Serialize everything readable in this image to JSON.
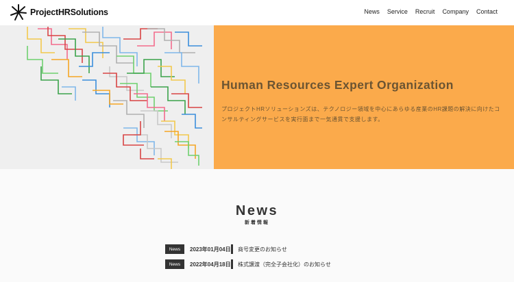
{
  "header": {
    "logo_text": "ProjectHRSolutions",
    "nav": [
      "News",
      "Service",
      "Recruit",
      "Company",
      "Contact"
    ]
  },
  "hero": {
    "title": "Human Resources Expert Organization",
    "description": "プロジェクトHRソリューションズは、テクノロジー領域を中心にあらゆる産業のHR課題の解決に向けたコンサルティングサービスを実行面まで一気通貫で支援します。",
    "accent_color": "#fbaa4b"
  },
  "news": {
    "title": "News",
    "subtitle": "新着情報",
    "items": [
      {
        "badge": "News",
        "date": "2023年01月04日",
        "text": "商号変更のお知らせ"
      },
      {
        "badge": "News",
        "date": "2022年04月18日",
        "text": "株式譲渡（完全子会社化）のお知らせ"
      }
    ]
  }
}
